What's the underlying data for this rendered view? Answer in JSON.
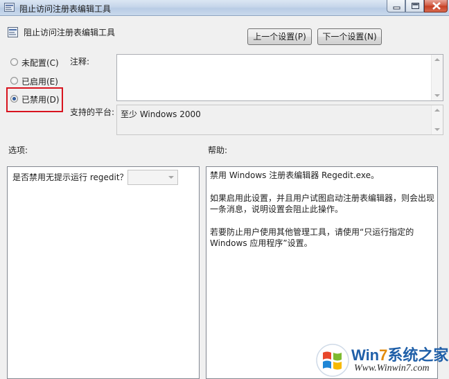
{
  "window": {
    "title": "阻止访问注册表编辑工具",
    "controls": [
      "minimize-icon",
      "maximize-icon",
      "close-icon"
    ]
  },
  "header": {
    "policy_title": "阻止访问注册表编辑工具",
    "prev_button": "上一个设置(P)",
    "next_button": "下一个设置(N)"
  },
  "state": {
    "options": [
      {
        "label": "未配置(C)",
        "selected": false
      },
      {
        "label": "已启用(E)",
        "selected": false
      },
      {
        "label": "已禁用(D)",
        "selected": true
      }
    ],
    "highlight_color": "#d8131e"
  },
  "comment": {
    "label": "注释:",
    "value": ""
  },
  "platform": {
    "label": "支持的平台:",
    "value": "至少 Windows 2000"
  },
  "options_section": {
    "label": "选项:",
    "item_label": "是否禁用无提示运行 regedit？",
    "dropdown_value": ""
  },
  "help_section": {
    "label": "帮助:",
    "paragraphs": [
      "禁用 Windows 注册表编辑器 Regedit.exe。",
      "如果启用此设置，并且用户试图启动注册表编辑器，则会出现一条消息，说明设置会阻止此操作。",
      "若要防止用户使用其他管理工具，请使用“只运行指定的 Windows 应用程序”设置。"
    ]
  },
  "watermark": {
    "brand_win": "Win",
    "brand_num": "7",
    "brand_rest": "系统之家",
    "url": "Www.Winwin7.com"
  }
}
